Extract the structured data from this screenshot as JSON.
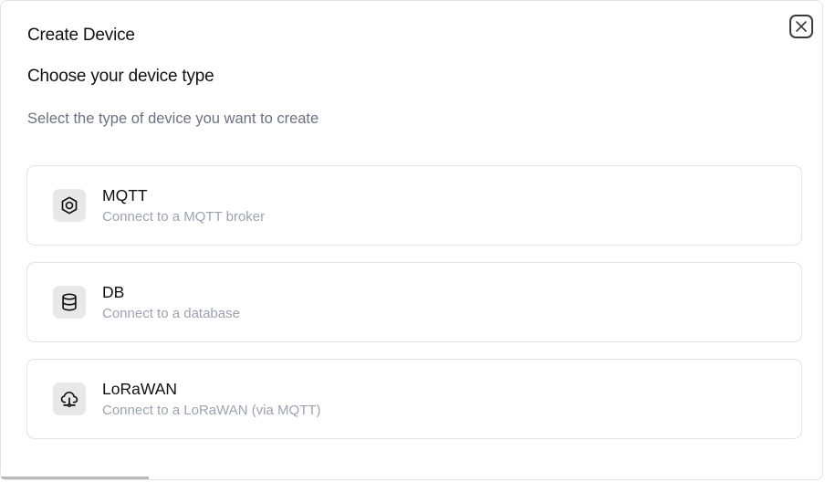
{
  "dialog": {
    "title": "Create Device",
    "subtitle": "Choose your device type",
    "description": "Select the type of device you want to create",
    "close_icon": "close-icon"
  },
  "options": [
    {
      "label": "MQTT",
      "description": "Connect to a MQTT broker",
      "icon": "hexagon-icon"
    },
    {
      "label": "DB",
      "description": "Connect to a database",
      "icon": "database-icon"
    },
    {
      "label": "LoRaWAN",
      "description": "Connect to a LoRaWAN (via MQTT)",
      "icon": "cloud-network-icon"
    }
  ],
  "colors": {
    "text": "#111111",
    "muted": "#6b7280",
    "muted_light": "#9ca3af",
    "border": "#e3e3e3",
    "icon_bg": "#e8e8e8"
  }
}
